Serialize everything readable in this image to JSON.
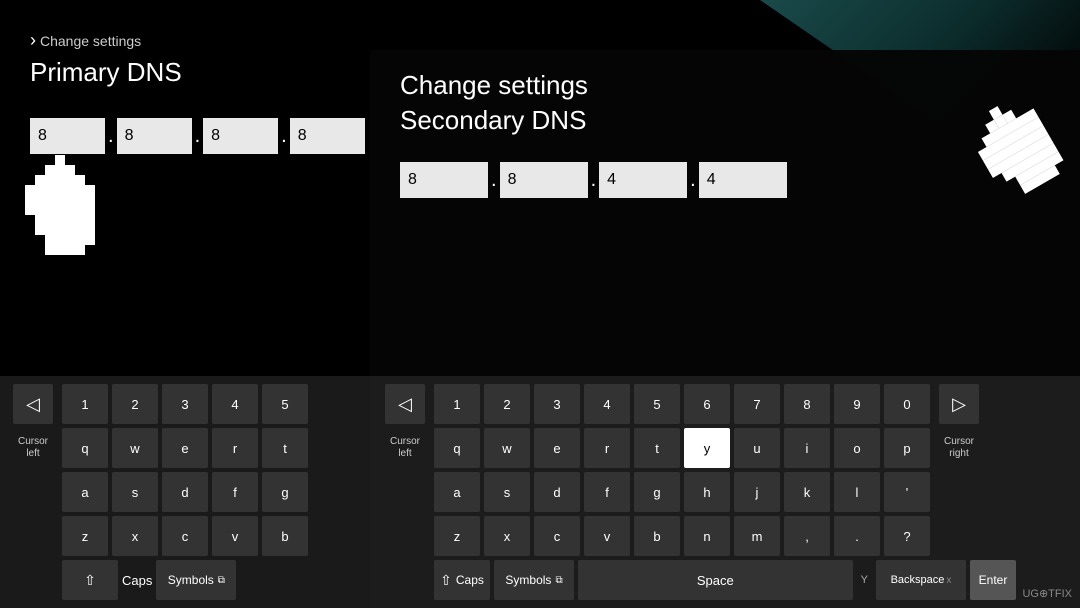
{
  "background": {
    "accent_color": "#1a4a4a"
  },
  "panel_primary": {
    "breadcrumb": "Change settings",
    "title": "Primary DNS",
    "fields": [
      "8",
      "8",
      "8",
      "8"
    ]
  },
  "panel_secondary": {
    "title_line1": "Change settings",
    "title_line2": "Secondary DNS",
    "fields": [
      "8",
      "8",
      "4",
      "4"
    ]
  },
  "keyboard_primary": {
    "cursor_left_label": "Cursor\nleft",
    "cursor_left_arrow": "◁",
    "rows": {
      "numbers": [
        "1",
        "2",
        "3",
        "4",
        "5"
      ],
      "row1": [
        "q",
        "w",
        "e",
        "r",
        "t"
      ],
      "row2": [
        "a",
        "s",
        "d",
        "f",
        "g"
      ],
      "row3": [
        "z",
        "x",
        "c",
        "v",
        "b"
      ]
    },
    "caps_label": "Caps",
    "symbols_label": "Symbols"
  },
  "keyboard_secondary": {
    "cursor_left_label": "Cursor\nleft",
    "cursor_right_label": "Cursor\nright",
    "rows": {
      "numbers": [
        "1",
        "2",
        "3",
        "4",
        "5",
        "6",
        "7",
        "8",
        "9",
        "0"
      ],
      "row1": [
        "q",
        "w",
        "e",
        "r",
        "t",
        "y",
        "u",
        "i",
        "o",
        "p"
      ],
      "row2": [
        "a",
        "s",
        "d",
        "f",
        "g",
        "h",
        "j",
        "k",
        "l",
        "'"
      ],
      "row3": [
        "z",
        "x",
        "c",
        "v",
        "b",
        "n",
        "m",
        ",",
        ".",
        "?"
      ]
    },
    "caps_label": "Caps",
    "symbols_label": "Symbols",
    "space_label": "Space",
    "backspace_label": "Backspace",
    "enter_label": "Enter",
    "highlighted_key": "y",
    "y_indicator": "Y"
  },
  "watermark": "UG⊕TFIX"
}
